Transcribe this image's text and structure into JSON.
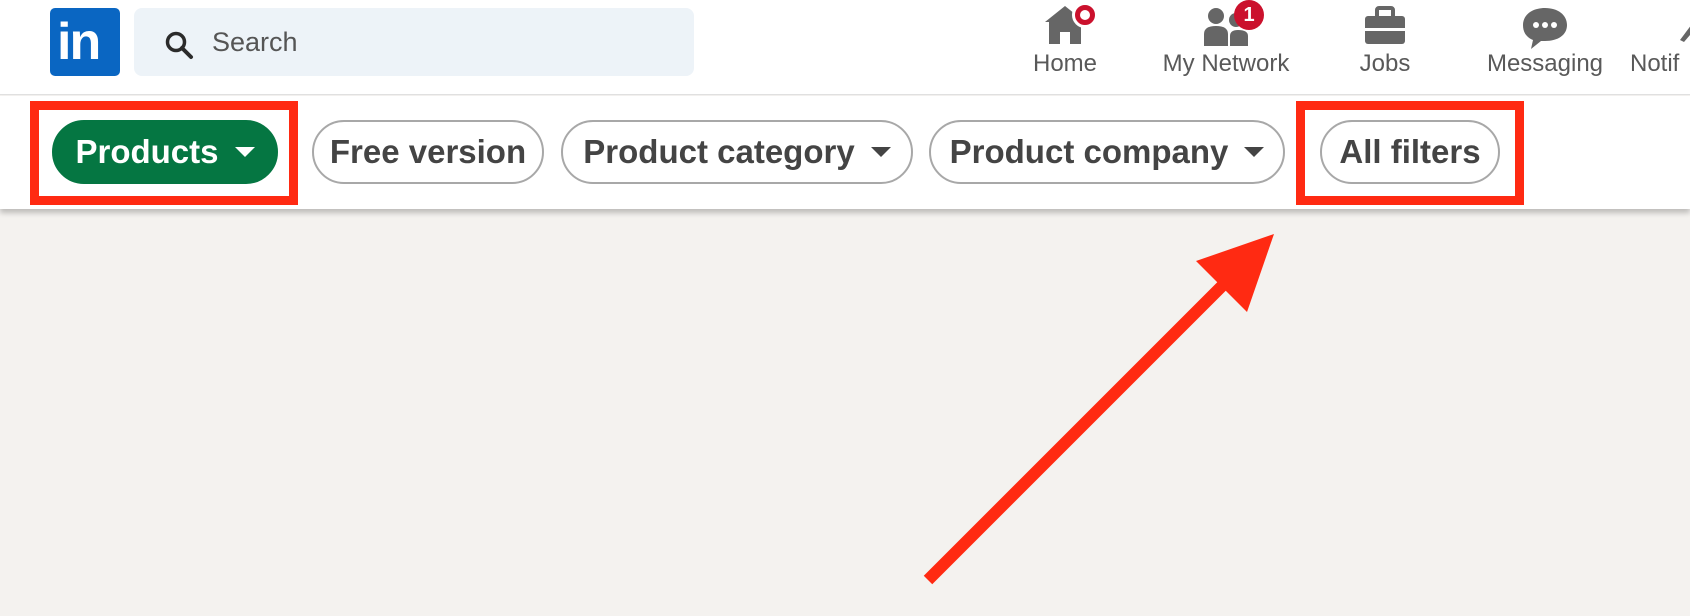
{
  "brand": {
    "logo_text": "in",
    "color": "#0a66c2"
  },
  "search": {
    "placeholder": "Search",
    "icon": "search-icon"
  },
  "nav": {
    "items": [
      {
        "label": "Home",
        "icon": "home-icon",
        "badge": "dot"
      },
      {
        "label": "My Network",
        "icon": "network-icon",
        "badge": "1"
      },
      {
        "label": "Jobs",
        "icon": "briefcase-icon"
      },
      {
        "label": "Messaging",
        "icon": "messaging-icon"
      },
      {
        "label": "Notif",
        "icon": "bell-icon"
      }
    ],
    "badge_color": "#cb112d"
  },
  "filters": {
    "items": [
      {
        "label": "Products",
        "active": true,
        "has_dropdown": true
      },
      {
        "label": "Free version",
        "active": false,
        "has_dropdown": false
      },
      {
        "label": "Product category",
        "active": false,
        "has_dropdown": true
      },
      {
        "label": "Product company",
        "active": false,
        "has_dropdown": true
      },
      {
        "label": "All filters",
        "active": false,
        "has_dropdown": false
      }
    ],
    "active_color": "#057642"
  },
  "annotations": {
    "highlight_color": "#ff2a12",
    "highlighted": [
      "Products",
      "All filters"
    ],
    "arrow_points_to": "All filters"
  }
}
